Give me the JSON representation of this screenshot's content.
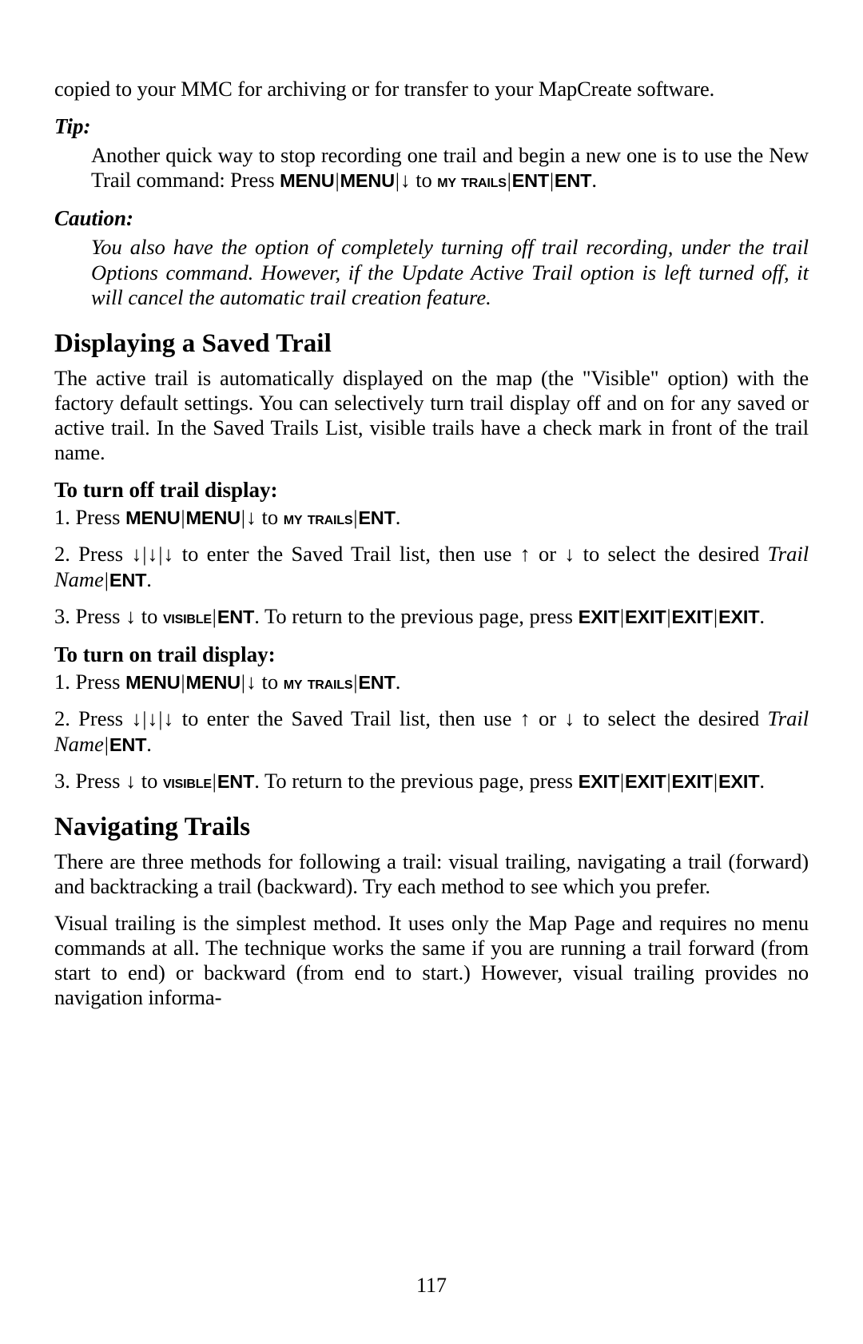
{
  "page": {
    "number": "117"
  },
  "intro": {
    "text": "copied to your MMC for archiving or for transfer to your MapCreate software."
  },
  "tip": {
    "heading": "Tip:",
    "line_a": "Another quick way to stop recording one trail and begin a new one is to use the New Trail command: Press",
    "keys": [
      "MENU",
      "MENU"
    ],
    "arrow_down": "↓",
    "to_word": "to",
    "target_small_caps": "My Trails",
    "keys_after": [
      "ENT",
      "ENT"
    ],
    "period": ".",
    "separator": "|"
  },
  "caution": {
    "heading": "Caution:",
    "text": "You also have the option of completely turning off trail recording, under the trail Options command. However, if the Update Active Trail option is left turned off, it will cancel the automatic trail creation feature."
  },
  "displaying": {
    "heading": "Displaying a Saved Trail",
    "intro": "The active trail is automatically displayed on the map (the \"Visible\" option) with the factory default settings. You can selectively turn trail display off and on for any saved or active trail. In the Saved Trails List, visible trails have a check mark in front of the trail name."
  },
  "turn_off": {
    "heading": "To turn off trail display:",
    "step1": {
      "num": "1. Press",
      "key_menu_1": "MENU",
      "key_menu_2": "MENU",
      "arrow": "↓",
      "to": "to",
      "my_trails": "My Trails",
      "key_ent": "ENT",
      "period": "."
    },
    "step2": {
      "num": "2. Press",
      "arrow1": "↓",
      "arrow2": "↓",
      "arrow3": "↓",
      "mid": "to enter the Saved Trail list, then use",
      "arrow_up": "↑",
      "or": "or",
      "arrow_dn": "↓",
      "tail": "to select the desired",
      "trail_name": "Trail Name",
      "key_ent": "ENT",
      "period": "."
    },
    "step3": {
      "num": "3. Press",
      "arrow": "↓",
      "to": "to",
      "visible": "Visible",
      "key_ent": "ENT",
      "mid": ". To return to the previous page, press",
      "key_exit_1": "EXIT",
      "key_exit_2": "EXIT",
      "key_exit_3": "EXIT",
      "key_exit_4": "EXIT",
      "period": "."
    }
  },
  "turn_on": {
    "heading": "To turn on trail display:",
    "step1": {
      "num": "1. Press",
      "key_menu_1": "MENU",
      "key_menu_2": "MENU",
      "arrow": "↓",
      "to": "to",
      "my_trails": "My Trails",
      "key_ent": "ENT",
      "period": "."
    },
    "step2": {
      "num": "2. Press",
      "arrow1": "↓",
      "arrow2": "↓",
      "arrow3": "↓",
      "mid": "to enter the Saved Trail list, then use",
      "arrow_up": "↑",
      "or": "or",
      "arrow_dn": "↓",
      "tail": "to select the desired",
      "trail_name": "Trail Name",
      "key_ent": "ENT",
      "period": "."
    },
    "step3": {
      "num": "3. Press",
      "arrow": "↓",
      "to": "to",
      "visible": "Visible",
      "key_ent": "ENT",
      "mid": ". To return to the previous page, press",
      "key_exit_1": "EXIT",
      "key_exit_2": "EXIT",
      "key_exit_3": "EXIT",
      "key_exit_4": "EXIT",
      "period": "."
    }
  },
  "navigating": {
    "heading": "Navigating Trails",
    "para1": "There are three methods for following a trail: visual trailing, navigating a trail (forward) and backtracking a trail (backward). Try each method to see which you prefer.",
    "para2": "Visual trailing is the simplest method. It uses only the Map Page and requires no menu commands at all. The technique works the same if you are running a trail forward (from start to end) or backward (from end to start.) However, visual trailing provides no navigation informa-"
  },
  "symbols": {
    "pipe": "|"
  }
}
